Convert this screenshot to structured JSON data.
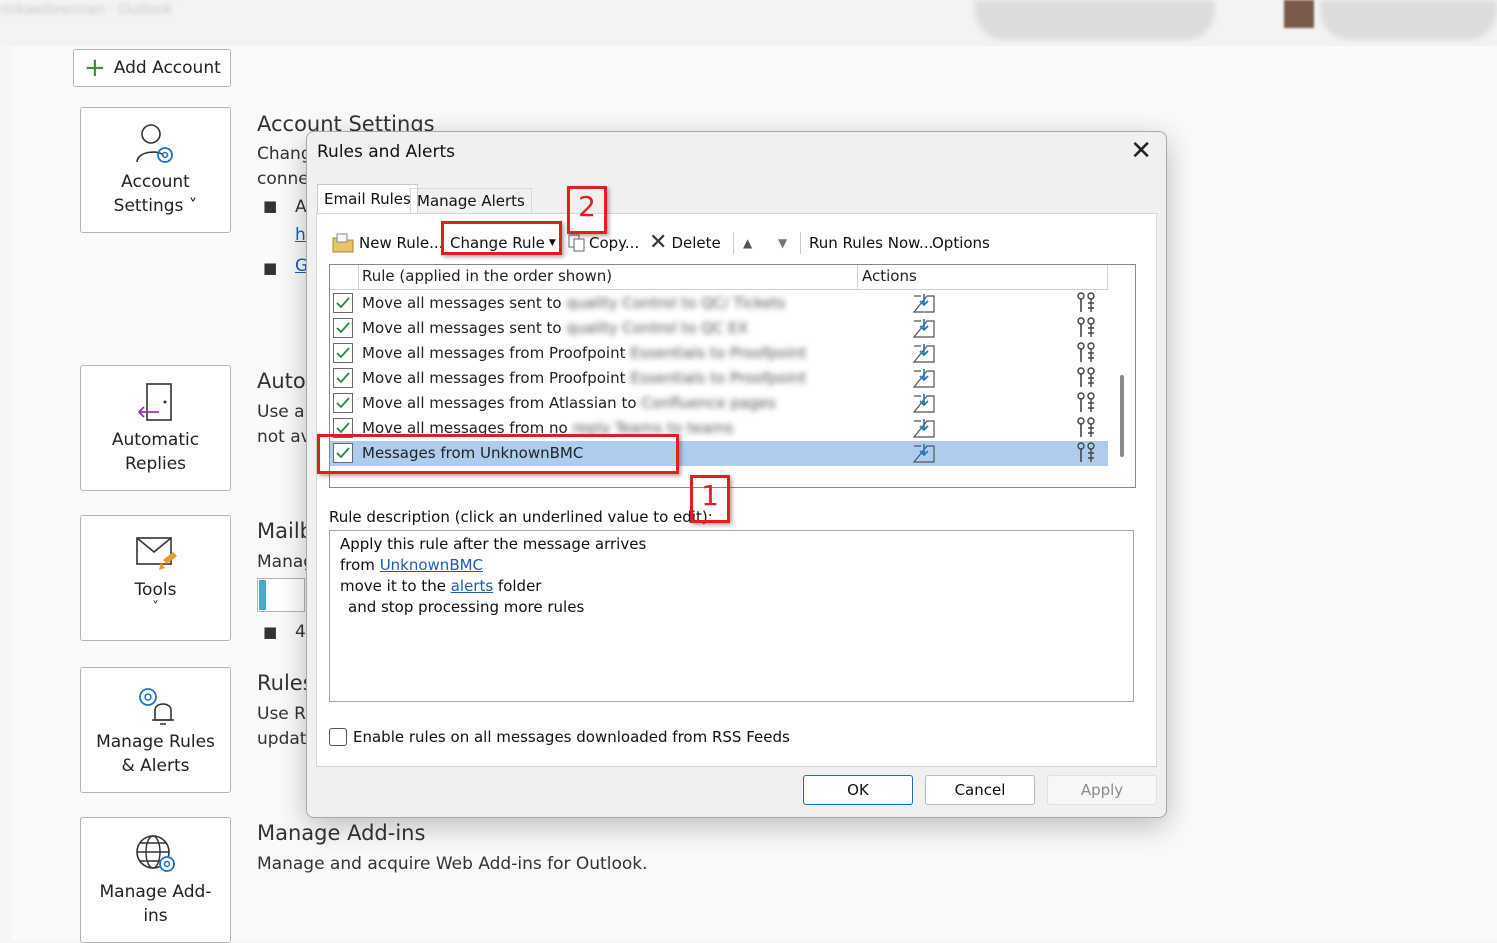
{
  "backstage": {
    "add_account_label": "Add Account",
    "tiles": [
      {
        "line1": "Account",
        "line2": "Settings ˅"
      },
      {
        "line1": "Automatic",
        "line2": "Replies"
      },
      {
        "line1": "Tools",
        "chevron": "˅"
      },
      {
        "line1": "Manage Rules",
        "line2": "& Alerts"
      },
      {
        "line1": "Manage Add-",
        "line2": "ins"
      }
    ],
    "sections": {
      "account_title": "Account Settings",
      "account_line1": "Chang",
      "account_line2": "conne",
      "account_bullet1": "A",
      "account_link1": "h",
      "account_bullet2_link": "G",
      "auto_title": "Auto",
      "auto_line1": "Use au",
      "auto_line2": "not av",
      "mailbox_title": "Mailb",
      "mailbox_line1": "Manag",
      "mailbox_bullet": "4",
      "rules_title": "Rules",
      "rules_line1": "Use Ru",
      "rules_line2": "updat",
      "addins_title": "Manage Add-ins",
      "addins_text": "Manage and acquire Web Add-ins for Outlook."
    }
  },
  "dialog": {
    "title": "Rules and Alerts",
    "close_glyph": "✕",
    "tabs": [
      "Email Rules",
      "Manage Alerts"
    ],
    "toolbar": {
      "new_rule": "New Rule...",
      "change_rule": "Change Rule",
      "copy": "Copy...",
      "delete": "Delete",
      "run_rules_now": "Run Rules Now...",
      "options": "Options"
    },
    "columns": [
      "Rule (applied in the order shown)",
      "Actions"
    ],
    "rules": [
      {
        "text": "Move all messages sent to",
        "hidden": "quality Control to QC/ Tickets"
      },
      {
        "text": "Move all messages sent to",
        "hidden": "quality Control to QC EX"
      },
      {
        "text": "Move all messages from Proofpoint",
        "hidden": "Essentials to Proofpoint"
      },
      {
        "text": "Move all messages from Proofpoint",
        "hidden": "Essentials to Proofpoint"
      },
      {
        "text": "Move all messages from Atlassian to",
        "hidden": "Confluence pages"
      },
      {
        "text": "Move all messages from no",
        "hidden": "reply Teams to teams"
      },
      {
        "text": "Messages from UnknownBMC",
        "hidden": ""
      }
    ],
    "description_label": "Rule description (click an underlined value to edit):",
    "description": {
      "line1": "Apply this rule after the message arrives",
      "line2_prefix": "from ",
      "line2_link": "UnknownBMC",
      "line3_prefix": "move it to the ",
      "line3_link": "alerts",
      "line3_suffix": " folder",
      "line4": "and stop processing more rules"
    },
    "rss_label": "Enable rules on all messages downloaded from RSS Feeds",
    "buttons": {
      "ok": "OK",
      "cancel": "Cancel",
      "apply": "Apply"
    }
  },
  "annotations": {
    "step1": "1",
    "step2": "2"
  },
  "colors": {
    "highlight": "#aecdee",
    "annotation_red": "#e02020",
    "link": "#1a5fb4"
  }
}
